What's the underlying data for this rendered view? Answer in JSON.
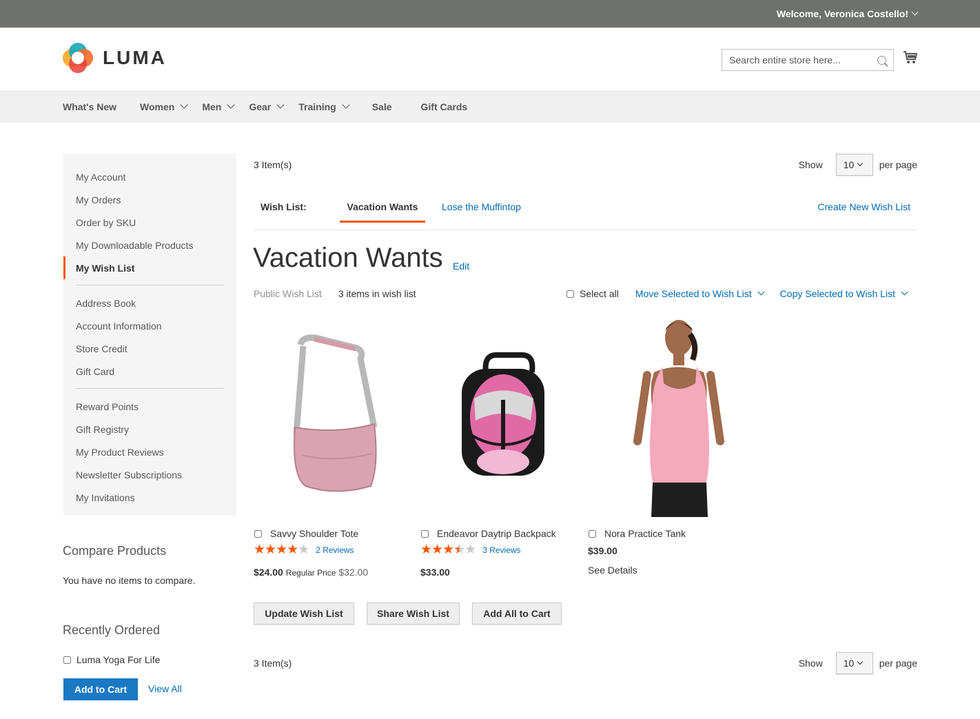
{
  "topbar": {
    "welcome": "Welcome, Veronica Costello!"
  },
  "header": {
    "logo_text": "LUMA",
    "search_placeholder": "Search entire store here..."
  },
  "nav": {
    "items": [
      {
        "label": "What's New"
      },
      {
        "label": "Women"
      },
      {
        "label": "Men"
      },
      {
        "label": "Gear"
      },
      {
        "label": "Training"
      },
      {
        "label": "Sale"
      },
      {
        "label": "Gift Cards"
      }
    ]
  },
  "sidebar": {
    "items": [
      "My Account",
      "My Orders",
      "Order by SKU",
      "My Downloadable Products",
      "My Wish List",
      "Address Book",
      "Account Information",
      "Store Credit",
      "Gift Card",
      "Reward Points",
      "Gift Registry",
      "My Product Reviews",
      "Newsletter Subscriptions",
      "My Invitations"
    ]
  },
  "compare": {
    "title": "Compare Products",
    "empty": "You have no items to compare."
  },
  "recent": {
    "title": "Recently Ordered",
    "item": "Luma Yoga For Life",
    "add_to_cart": "Add to Cart",
    "view_all": "View All"
  },
  "toolbar": {
    "count": "3 Item(s)",
    "show": "Show",
    "limit": "10",
    "per_page": "per page"
  },
  "tabs": {
    "label": "Wish List:",
    "active": "Vacation Wants",
    "other": "Lose the Muffintop",
    "create": "Create New Wish List"
  },
  "wishlist": {
    "title": "Vacation Wants",
    "edit": "Edit",
    "visibility": "Public Wish List",
    "count": "3 items in wish list",
    "select_all": "Select all",
    "move": "Move Selected to Wish List",
    "copy": "Copy Selected to Wish List"
  },
  "products": [
    {
      "name": "Savvy Shoulder Tote",
      "reviews": "2 Reviews",
      "price": "$24.00",
      "regular_label": "Regular Price",
      "regular_price": "$32.00",
      "rating": 4
    },
    {
      "name": "Endeavor Daytrip Backpack",
      "reviews": "3 Reviews",
      "price": "$33.00",
      "rating": 3.5
    },
    {
      "name": "Nora Practice Tank",
      "price": "$39.00",
      "details": "See Details"
    }
  ],
  "buttons": {
    "update": "Update Wish List",
    "share": "Share Wish List",
    "add_all": "Add All to Cart"
  },
  "colors": {
    "accent": "#ff5501",
    "link": "#006bb4",
    "primary": "#1979c3",
    "topbar": "#6e716e"
  }
}
